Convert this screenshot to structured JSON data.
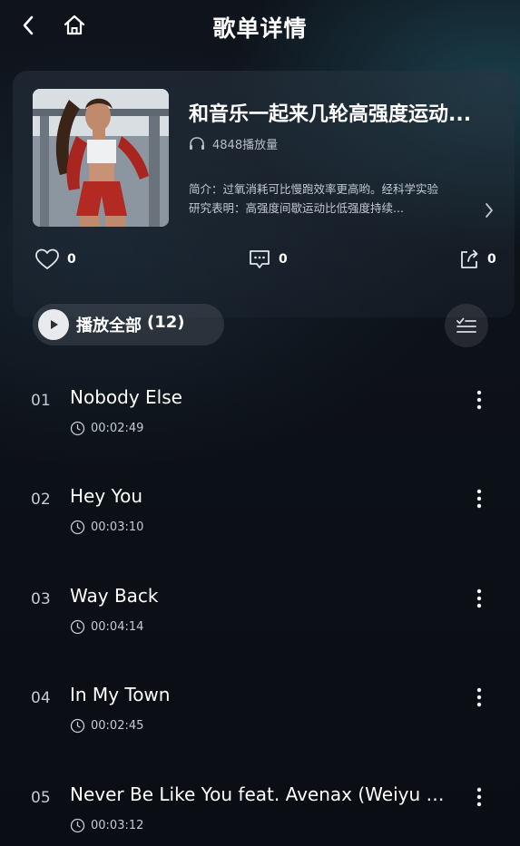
{
  "header": {
    "title": "歌单详情"
  },
  "playlist": {
    "title": "和音乐一起来几轮高强度运动...",
    "play_count": "4848播放量",
    "description_line1": "简介：过氧消耗可比慢跑效率更高哟。经科学实验",
    "description_line2": "研究表明：高强度间歇运动比低强度持续...",
    "likes": "0",
    "comments": "0",
    "shares": "0"
  },
  "controls": {
    "play_all_label": "播放全部",
    "play_all_count": "(12)"
  },
  "songs": [
    {
      "num": "01",
      "title": "Nobody Else",
      "duration": "00:02:49"
    },
    {
      "num": "02",
      "title": "Hey You",
      "duration": "00:03:10"
    },
    {
      "num": "03",
      "title": "Way Back",
      "duration": "00:04:14"
    },
    {
      "num": "04",
      "title": "In My Town",
      "duration": "00:02:45"
    },
    {
      "num": "05",
      "title": "Never Be Like You feat. Avenax (Weiyu S...",
      "duration": "00:03:12"
    }
  ],
  "icons": {
    "back": "chevron-left-icon",
    "home": "home-icon",
    "headphones": "headphones-icon",
    "like": "heart-icon",
    "comment": "comment-icon",
    "share": "share-icon",
    "play": "play-icon",
    "manage": "list-manage-icon",
    "clock": "clock-icon",
    "more": "more-vertical-icon"
  },
  "colors": {
    "background": "#0c0e16",
    "card": "#2a3440",
    "text_secondary": "#c6cbd2"
  }
}
